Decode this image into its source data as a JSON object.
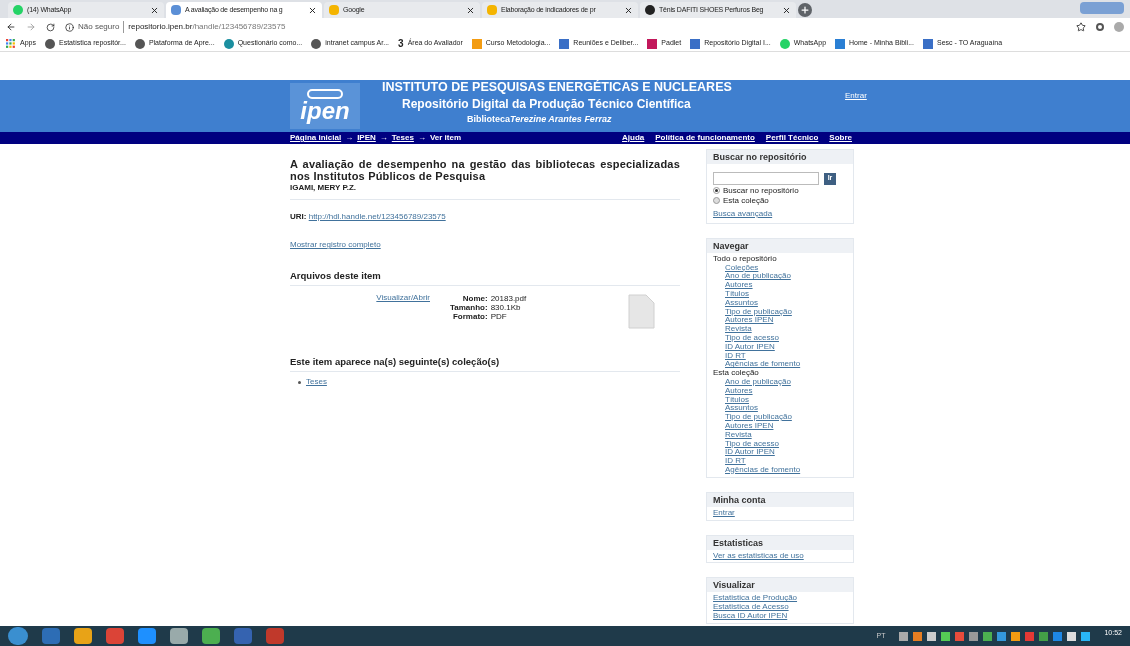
{
  "browser": {
    "tabs": [
      {
        "title": "(14) WhatsApp",
        "selected": false
      },
      {
        "title": "A avaliação de desempenho na g",
        "selected": true
      },
      {
        "title": "Google",
        "selected": false
      },
      {
        "title": "Elaboração de indicadores de pr",
        "selected": false
      },
      {
        "title": "Tênis DAFITI SHOES Perfuros Beg",
        "selected": false
      }
    ],
    "security": "Não seguro",
    "url_host": "repositorio.ipen.br",
    "url_path": "/handle/123456789/23575",
    "bookmarks": [
      {
        "label": "Apps"
      },
      {
        "label": "Estatística repositór..."
      },
      {
        "label": "Plataforma de Apre..."
      },
      {
        "label": "Questionário como..."
      },
      {
        "label": "intranet campus Ar..."
      },
      {
        "label": "Área do Avaliador",
        "icon_text": "3"
      },
      {
        "label": "Curso Metodologia..."
      },
      {
        "label": "Reuniões e Deliber..."
      },
      {
        "label": "Padlet"
      },
      {
        "label": "Repositório Digital I..."
      },
      {
        "label": "WhatsApp"
      },
      {
        "label": "Home - Minha Bibli..."
      },
      {
        "label": "Sesc - TO Araguaína"
      }
    ]
  },
  "header": {
    "logo": "ipen",
    "institute": "INSTITUTO DE PESQUISAS ENERGÉTICAS E NUCLEARES",
    "repository": "Repositório Digital da Produção Técnico Científica",
    "library_label": "Biblioteca",
    "library_name": "Terezine Arantes Ferraz",
    "login": "Entrar"
  },
  "nav": {
    "separator": "→",
    "breadcrumbs": [
      {
        "label": "Página inicial",
        "link": true
      },
      {
        "label": "IPEN",
        "link": true
      },
      {
        "label": "Teses",
        "link": true
      },
      {
        "label": "Ver item",
        "link": false
      }
    ],
    "links": [
      "Ajuda",
      "Política de funcionamento",
      "Perfil Técnico",
      "Sobre"
    ]
  },
  "item": {
    "title": "A avaliação de desempenho na gestão das bibliotecas especializadas nos Institutos Públicos de Pesquisa",
    "author": "IGAMI, MERY P.Z.",
    "uri_label": "URI:",
    "uri": "http://hdl.handle.net/123456789/23575",
    "full_record": "Mostrar registro completo",
    "files_heading": "Arquivos deste item",
    "open_link": "Visualizar/Abrir",
    "file_fields": [
      {
        "label": "Nome:",
        "value": "20183.pdf"
      },
      {
        "label": "Tamanho:",
        "value": "830.1Kb"
      },
      {
        "label": "Formato:",
        "value": "PDF"
      }
    ],
    "collections_heading": "Este item aparece na(s) seguinte(s) coleção(s)",
    "collections": [
      "Teses"
    ]
  },
  "sidebar": {
    "search": {
      "title": "Buscar no repositório",
      "button": "Ir",
      "scopes": [
        {
          "label": "Buscar no repositório",
          "selected": true
        },
        {
          "label": "Esta coleção",
          "selected": false
        }
      ],
      "advanced": "Busca avançada"
    },
    "browse": {
      "title": "Navegar",
      "groups": [
        {
          "label": "Todo o repositório",
          "links": [
            "Coleções",
            "Ano de publicação",
            "Autores",
            "Títulos",
            "Assuntos",
            "Tipo de publicação",
            "Autores IPEN",
            "Revista",
            "Tipo de acesso",
            "ID Autor IPEN",
            "ID RT",
            "Agências de fomento"
          ]
        },
        {
          "label": "Esta coleção",
          "links": [
            "Ano de publicação",
            "Autores",
            "Títulos",
            "Assuntos",
            "Tipo de publicação",
            "Autores IPEN",
            "Revista",
            "Tipo de acesso",
            "ID Autor IPEN",
            "ID RT",
            "Agências de fomento"
          ]
        }
      ]
    },
    "boxes": [
      {
        "title": "Minha conta",
        "links": [
          "Entrar"
        ]
      },
      {
        "title": "Estatisticas",
        "links": [
          "Ver as estatisticas de uso"
        ]
      },
      {
        "title": "Visualizar",
        "links": [
          "Estatistica de Produção",
          "Estatistica de Acesso",
          "Busca ID Autor IPEN"
        ]
      }
    ]
  },
  "taskbar": {
    "language": "PT",
    "time": "10:52"
  }
}
